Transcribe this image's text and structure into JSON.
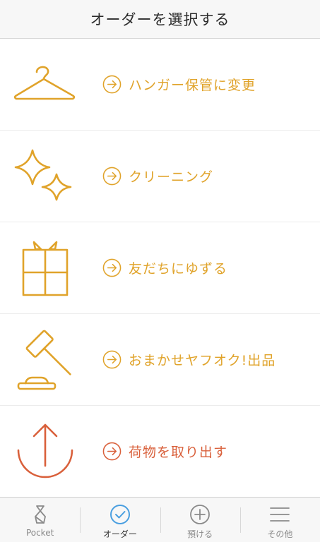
{
  "header": {
    "title": "オーダーを選択する"
  },
  "menu": {
    "items": [
      {
        "label": "ハンガー保管に変更",
        "icon": "hanger-icon",
        "color": "#e0a32a"
      },
      {
        "label": "クリーニング",
        "icon": "sparkle-icon",
        "color": "#e0a32a"
      },
      {
        "label": "友だちにゆずる",
        "icon": "gift-icon",
        "color": "#e0a32a"
      },
      {
        "label": "おまかせヤフオク!出品",
        "icon": "auction-gavel-icon",
        "color": "#e0a32a"
      },
      {
        "label": "荷物を取り出す",
        "icon": "take-out-arrow-icon",
        "color": "#d9603b"
      }
    ]
  },
  "tabbar": {
    "tabs": [
      {
        "label": "Pocket",
        "icon": "pocket-icon"
      },
      {
        "label": "オーダー",
        "icon": "check-circle-icon",
        "active": true
      },
      {
        "label": "預ける",
        "icon": "plus-circle-icon"
      },
      {
        "label": "その他",
        "icon": "menu-lines-icon"
      }
    ]
  }
}
